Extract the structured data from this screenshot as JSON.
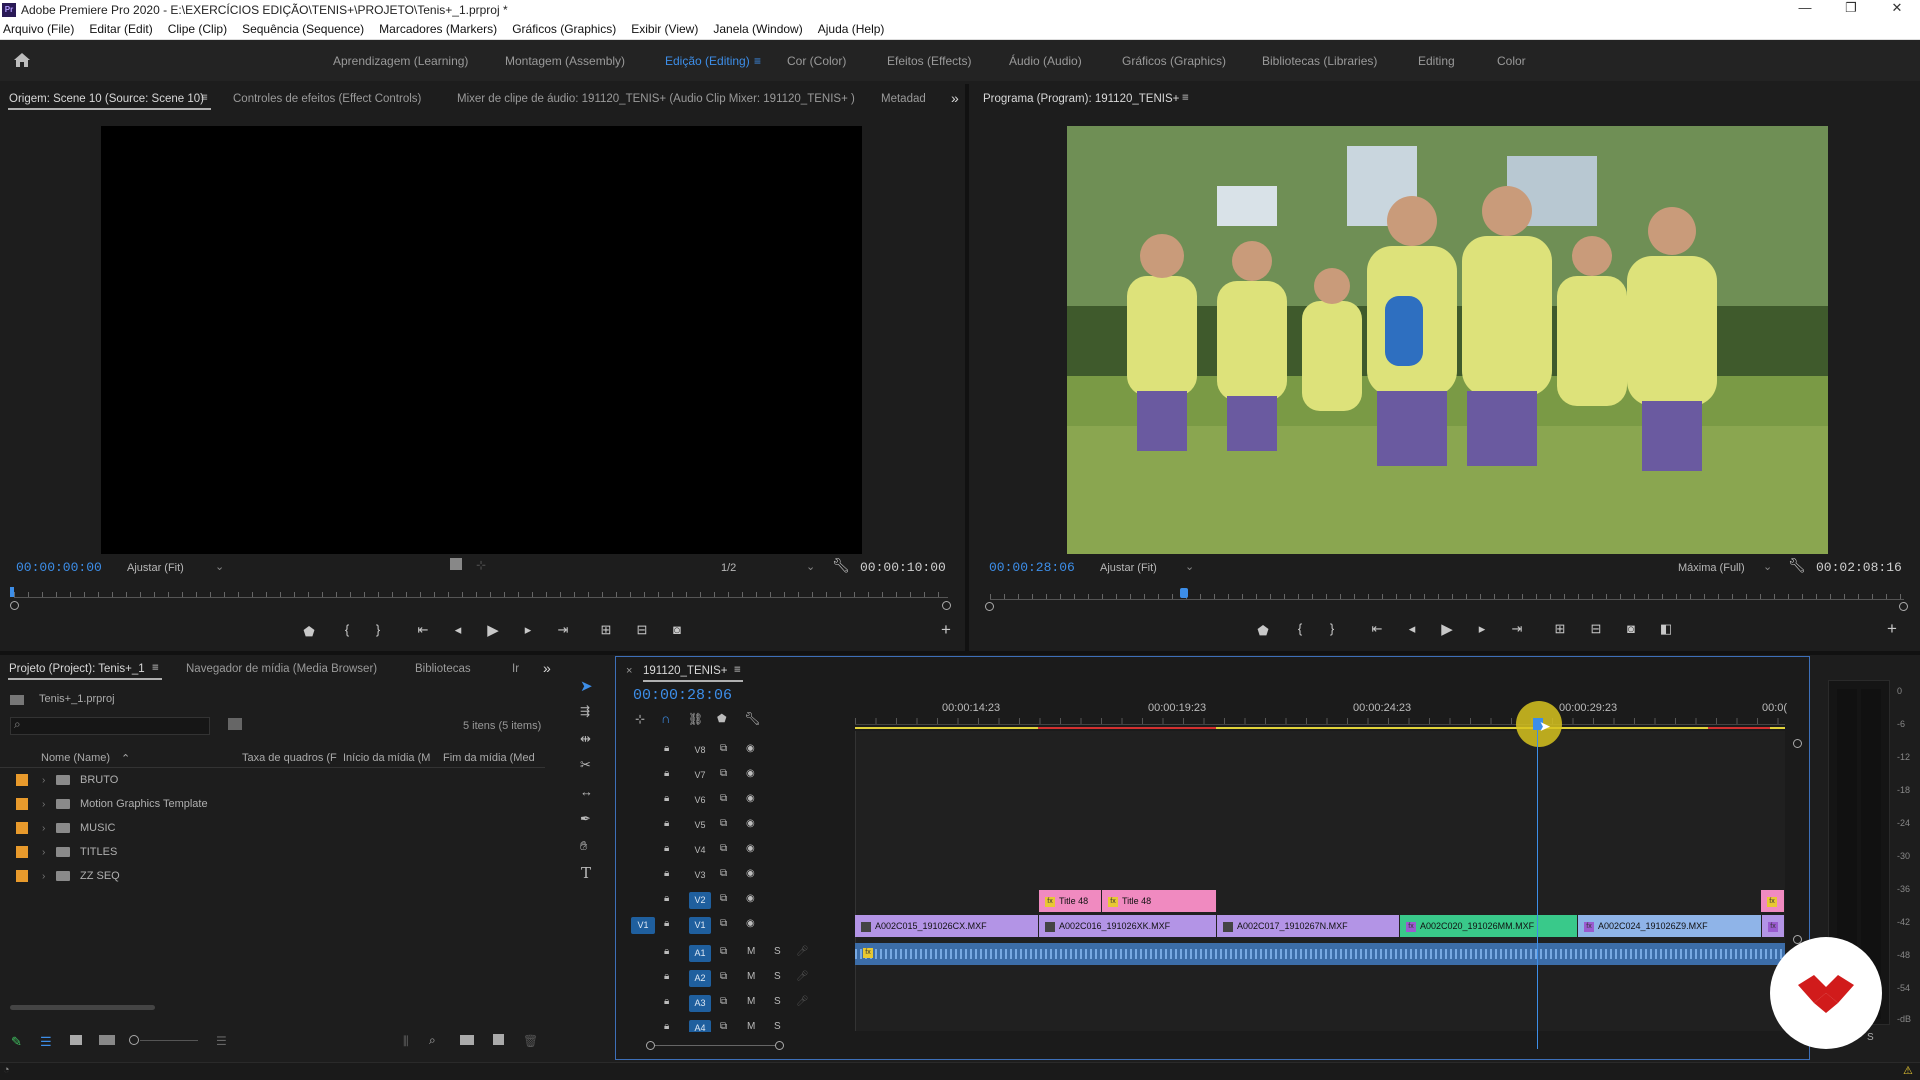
{
  "window": {
    "title": "Adobe Premiere Pro 2020 - E:\\EXERCÍCIOS EDIÇÃO\\TENIS+\\PROJETO\\Tenis+_1.prproj *",
    "logo_text": "Pr",
    "controls": [
      "—",
      "❐",
      "✕"
    ]
  },
  "menu": [
    "Arquivo (File)",
    "Editar (Edit)",
    "Clipe (Clip)",
    "Sequência (Sequence)",
    "Marcadores (Markers)",
    "Gráficos (Graphics)",
    "Exibir (View)",
    "Janela (Window)",
    "Ajuda (Help)"
  ],
  "workspaces": {
    "items": [
      "Aprendizagem (Learning)",
      "Montagem (Assembly)",
      "Edição (Editing)",
      "Cor (Color)",
      "Efeitos (Effects)",
      "Áudio (Audio)",
      "Gráficos (Graphics)",
      "Bibliotecas (Libraries)",
      "Editing",
      "Color"
    ],
    "active": "Edição (Editing)",
    "menu_glyph": "≡"
  },
  "source_panel": {
    "tabs": [
      "Origem: Scene 10 (Source: Scene 10)",
      "Controles de efeitos (Effect Controls)",
      "Mixer de clipe de áudio: 191120_TENIS+ (Audio Clip Mixer: 191120_TENIS+ )",
      "Metadad"
    ],
    "menu_glyph": "≡",
    "overflow": "»",
    "timecode_current": "00:00:00:00",
    "fit": "Ajustar (Fit)",
    "resolution": "1/2",
    "timecode_duration": "00:00:10:00",
    "add": "+"
  },
  "program_panel": {
    "tab": "Programa (Program): 191120_TENIS+",
    "menu_glyph": "≡",
    "timecode_current": "00:00:28:06",
    "fit": "Ajustar (Fit)",
    "resolution": "Máxima (Full)",
    "timecode_duration": "00:02:08:16",
    "add": "+",
    "image_description": "frame-children-walking"
  },
  "project_panel": {
    "tabs": [
      "Projeto (Project): Tenis+_1",
      "Navegador de mídia (Media Browser)",
      "Bibliotecas",
      "Ir"
    ],
    "menu_glyph": "≡",
    "overflow": "»",
    "project_file": "Tenis+_1.prproj",
    "item_count": "5 itens (5 items)",
    "columns": [
      "Nome (Name)",
      "Taxa de quadros (F",
      "Início da mídia (M",
      "Fim da mídia (Med"
    ],
    "sort_glyph": "⌃",
    "bins": [
      "BRUTO",
      "Motion Graphics Template",
      "MUSIC",
      "TITLES",
      "ZZ SEQ"
    ],
    "bin_color": "#e89a2c"
  },
  "timeline": {
    "sequence_name": "191120_TENIS+",
    "close_glyph": "×",
    "menu_glyph": "≡",
    "timecode": "00:00:28:06",
    "ruler_labels": [
      "00:00:14:23",
      "00:00:19:23",
      "00:00:24:23",
      "00:00:29:23",
      "00:0("
    ],
    "video_tracks": [
      "V8",
      "V7",
      "V6",
      "V5",
      "V4",
      "V3",
      "V2",
      "V1"
    ],
    "audio_tracks": [
      "A1",
      "A2",
      "A3",
      "A4"
    ],
    "source_patch": "V1",
    "audio_mute": "M",
    "audio_solo": "S",
    "title_clips": [
      "Title 48",
      "Title 48"
    ],
    "video_clips": [
      "A002C015_191026CX.MXF",
      "A002C016_191026XK.MXF",
      "A002C017_1910267N.MXF",
      "A002C020_191026MM.MXF",
      "A002C024_191026Z9.MXF"
    ],
    "fx_badge": "fx"
  },
  "meters": {
    "scale": [
      "0",
      "-6",
      "-12",
      "-18",
      "-24",
      "-30",
      "-36",
      "-42",
      "-48",
      "-54",
      "-dB"
    ],
    "solo": "S"
  },
  "tools": [
    "selection-tool",
    "track-select-tool",
    "ripple-edit-tool",
    "razor-tool",
    "slip-tool",
    "pen-tool",
    "hand-tool",
    "type-tool"
  ],
  "colors": {
    "accent": "#3d8ee8",
    "clip_video": "#b394e6",
    "clip_title": "#f08ac0",
    "clip_green": "#39c98a",
    "audio": "#3c6da8",
    "work_area": "#e0d23a",
    "render_red": "#d23030",
    "brand_red": "#d11b1b"
  }
}
